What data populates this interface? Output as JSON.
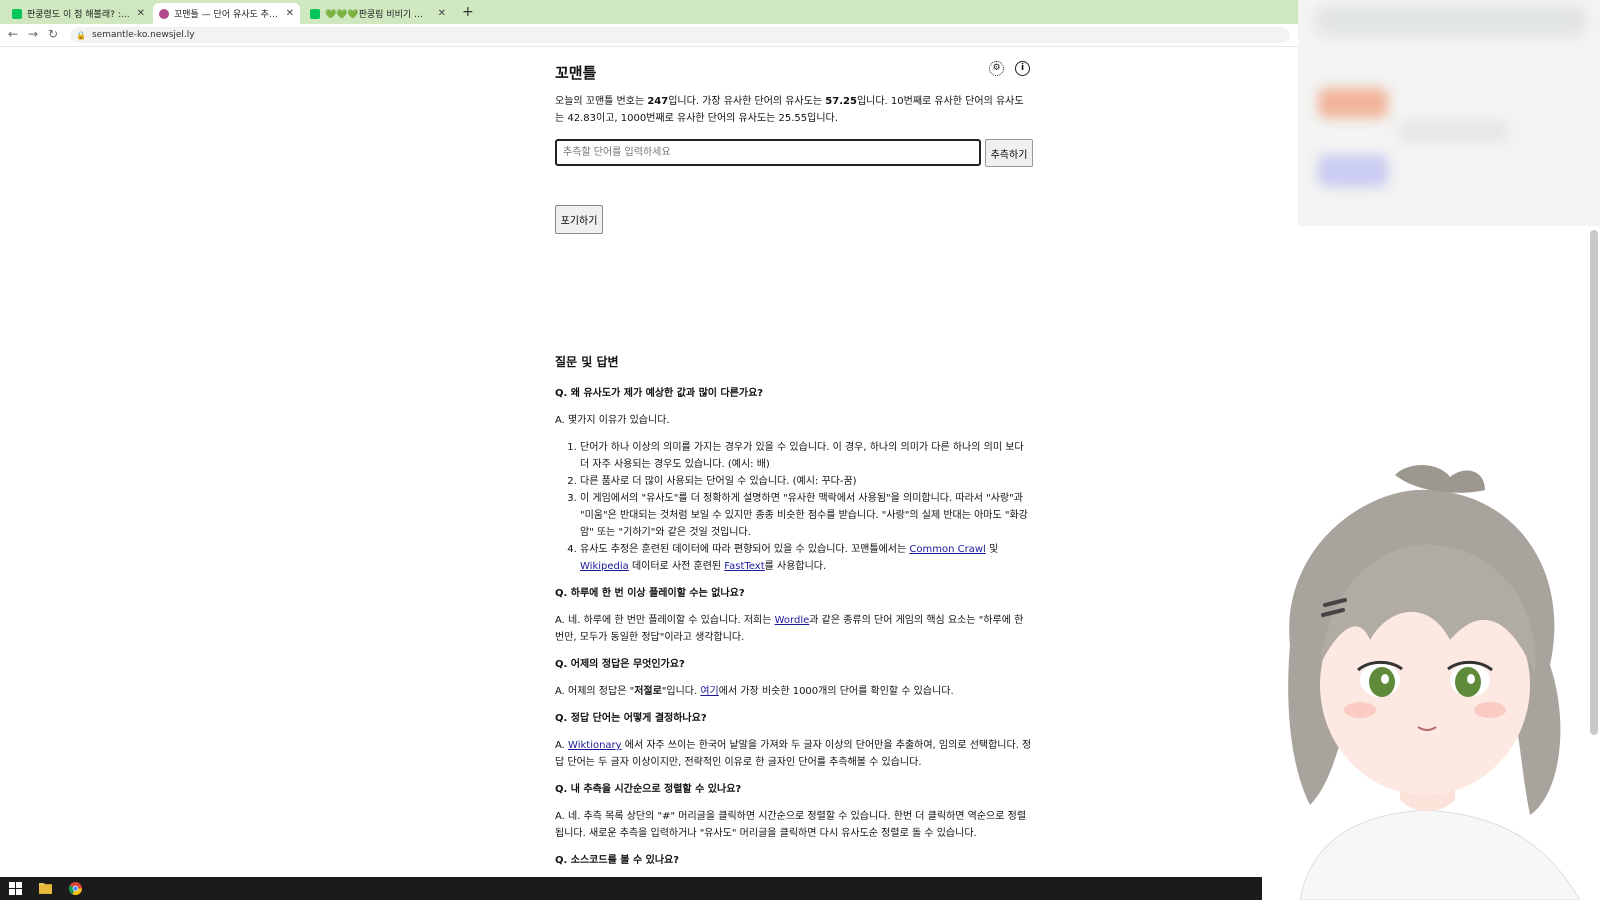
{
  "browser": {
    "tabs": [
      {
        "title": "판쿵령도 이 점 해볼래? : 네이버",
        "active": false
      },
      {
        "title": "꼬맨틀 — 단어 유사도 추측 게임",
        "active": true
      },
      {
        "title": "💚💚💚판쿵림 비비기 💚💚💚",
        "active": false
      }
    ],
    "new_tab": "+",
    "url": "semantle-ko.newsjel.ly"
  },
  "game": {
    "title": "꼬맨틀",
    "intro_1": "오늘의 꼬맨틀 번호는 ",
    "puzzle_no": "247",
    "intro_2": "입니다. 가장 유사한 단어의 유사도는 ",
    "top_sim": "57.25",
    "intro_3": "입니다. 10번째로 유사한 단어의 유사도는 42.83이고, 1000번째로 유사한 단어의 유사도는 25.55입니다.",
    "input_placeholder": "추측할 단어를 입력하세요",
    "guess_button": "추측하기",
    "giveup_button": "포기하기"
  },
  "faq": {
    "heading": "질문 및 답변",
    "q1": "Q. 왜 유사도가 제가 예상한 값과 많이 다른가요?",
    "a1": "A. 몇가지 이유가 있습니다.",
    "reasons": [
      "단어가 하나 이상의 의미를 가지는 경우가 있을 수 있습니다. 이 경우, 하나의 의미가 다른 하나의 의미 보다 더 자주 사용되는 경우도 있습니다. (예시: 배)",
      "다른 품사로 더 많이 사용되는 단어일 수 있습니다. (예시: 꾸다-꿈)",
      "이 게임에서의 \"유사도\"를 더 정확하게 설명하면 \"유사한 맥락에서 사용됨\"을 의미합니다. 따라서 \"사랑\"과 \"미움\"은 반대되는 것처럼 보일 수 있지만 종종 비슷한 점수를 받습니다. \"사랑\"의 실제 반대는 아마도 \"화강암\" 또는 \"기하기\"와 같은 것일 것입니다."
    ],
    "r4_pre": "유사도 추정은 훈련된 데이터에 따라 편향되어 있을 수 있습니다. 꼬맨틀에서는 ",
    "r4_link1": "Common Crawl",
    "r4_mid1": " 및 ",
    "r4_link2": "Wikipedia",
    "r4_mid2": " 데이터로 사전 훈련된 ",
    "r4_link3": "FastText",
    "r4_post": "를 사용합니다.",
    "q2": "Q. 하루에 한 번 이상 플레이할 수는 없나요?",
    "a2_pre": "A. 네. 하루에 한 번만 플레이할 수 있습니다. 저희는 ",
    "a2_link": "Wordle",
    "a2_post": "과 같은 종류의 단어 게임의 핵심 요소는 \"하루에 한 번만, 모두가 동일한 정답\"이라고 생각합니다.",
    "q3": "Q. 어제의 정답은 무엇인가요?",
    "a3_pre": "A. 어제의 정답은 \"",
    "a3_word": "저절로",
    "a3_mid": "\"입니다. ",
    "a3_link": "여기",
    "a3_post": "에서 가장 비슷한 1000개의 단어를 확인할 수 있습니다.",
    "q4": "Q. 정답 단어는 어떻게 결정하나요?",
    "a4_pre": "A. ",
    "a4_link": "Wiktionary",
    "a4_post": " 에서 자주 쓰이는 한국어 낱말을 가져와 두 글자 이상의 단어만을 추출하여, 임의로 선택합니다. 정답 단어는 두 글자 이상이지만, 전략적인 이유로 한 글자인 단어를 추측해볼 수 있습니다.",
    "q5": "Q. 내 추측을 시간순으로 정렬할 수 있나요?",
    "a5": "A. 네. 추측 목록 상단의 \"#\" 머리글을 클릭하면 시간순으로 정렬할 수 있습니다. 한번 더 클릭하면 역순으로 정렬됩니다. 새로운 추측을 입력하거나 \"유사도\" 머리글을 클릭하면 다시 유사도순 정렬로 돌 수 있습니다.",
    "q6": "Q. 소스코드를 볼 수 있나요?"
  }
}
